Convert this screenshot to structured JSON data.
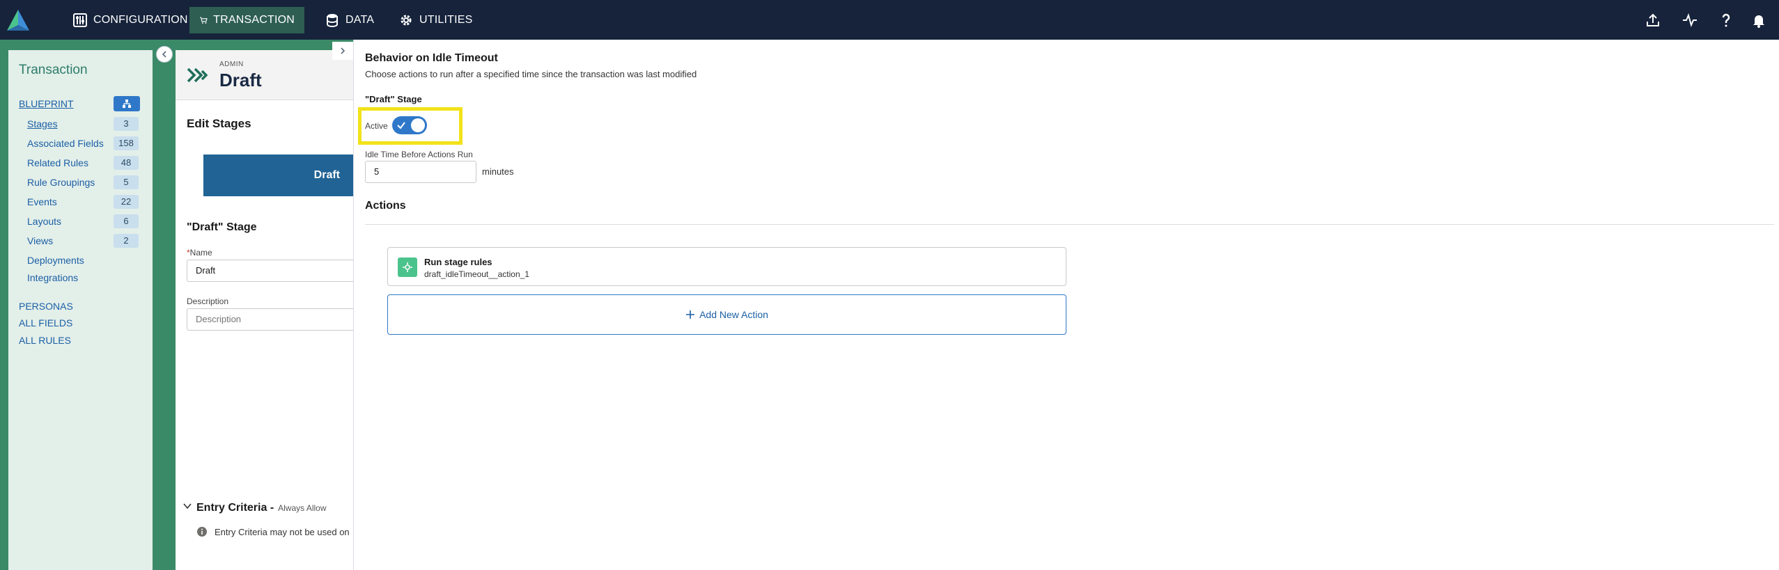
{
  "topnav": {
    "items": [
      {
        "label": "CONFIGURATION",
        "icon": "configuration-icon"
      },
      {
        "label": "TRANSACTION",
        "icon": "cart-icon",
        "active": true
      },
      {
        "label": "DATA",
        "icon": "database-icon"
      },
      {
        "label": "UTILITIES",
        "icon": "gear-icon"
      }
    ],
    "right_icons": [
      "upload-icon",
      "activity-icon",
      "help-icon",
      "bell-icon"
    ],
    "colors": {
      "bar": "#16233b",
      "active": "#2e5e52"
    }
  },
  "sidebar": {
    "title": "Transaction",
    "blueprint_label": "BLUEPRINT",
    "items": [
      {
        "label": "Stages",
        "count": "3"
      },
      {
        "label": "Associated Fields",
        "count": "158"
      },
      {
        "label": "Related Rules",
        "count": "48"
      },
      {
        "label": "Rule Groupings",
        "count": "5"
      },
      {
        "label": "Events",
        "count": "22"
      },
      {
        "label": "Layouts",
        "count": "6"
      },
      {
        "label": "Views",
        "count": "2"
      },
      {
        "label": "Deployments"
      },
      {
        "label": "Integrations"
      }
    ],
    "bottom_links": [
      "PERSONAS",
      "ALL FIELDS",
      "ALL RULES"
    ]
  },
  "middle": {
    "eyebrow": "ADMIN",
    "title": "Draft",
    "edit_stages": "Edit Stages",
    "stage_pill": "Draft",
    "stage_section": "\"Draft\" Stage",
    "name_label": "Name",
    "name_required": "*",
    "name_value": "Draft",
    "description_label": "Description",
    "description_placeholder": "Description",
    "entry_title": "Entry Criteria -",
    "entry_sub": "Always Allow",
    "entry_note": "Entry Criteria may not be used on"
  },
  "panel": {
    "title": "Behavior on Idle Timeout",
    "subtitle": "Choose actions to run after a specified time since the transaction was last modified",
    "stage_label": "\"Draft\" Stage",
    "active_label": "Active",
    "active_on": true,
    "idle_label": "Idle Time Before Actions Run",
    "idle_value": "5",
    "idle_unit": "minutes",
    "actions_title": "Actions",
    "action": {
      "name": "Run stage rules",
      "id": "draft_idleTimeout__action_1"
    },
    "add_action": "Add New Action",
    "colors": {
      "accent": "#2f78c9",
      "highlight": "#f2e21a",
      "action_icon": "#4bc38c"
    }
  }
}
